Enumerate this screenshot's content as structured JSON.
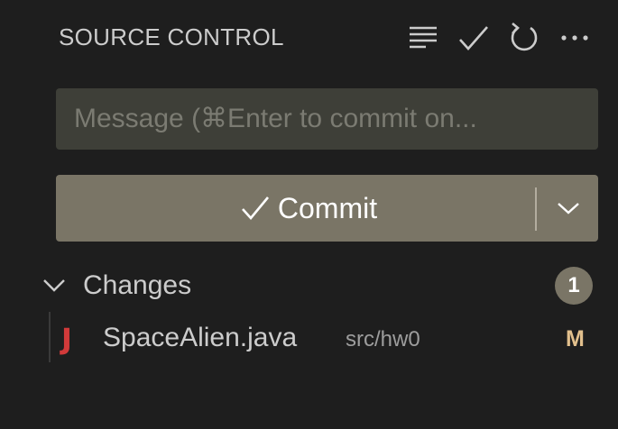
{
  "header": {
    "title": "SOURCE CONTROL",
    "actions": [
      {
        "name": "view-as-list-icon",
        "tooltip": ""
      },
      {
        "name": "commit-check-icon",
        "tooltip": ""
      },
      {
        "name": "refresh-icon",
        "tooltip": ""
      },
      {
        "name": "more-actions-icon",
        "tooltip": ""
      }
    ]
  },
  "message_input": {
    "value": "",
    "placeholder": "Message (⌘Enter to commit on..."
  },
  "commit_button": {
    "label": "Commit",
    "icon": "checkmark-icon",
    "dropdown_icon": "chevron-down-icon"
  },
  "changes": {
    "label": "Changes",
    "count": "1",
    "files": [
      {
        "icon_letter": "J",
        "name": "SpaceAlien.java",
        "path": "src/hw0",
        "status": "M"
      }
    ]
  },
  "colors": {
    "background": "#1e1e1e",
    "input_bg": "#3e3f38",
    "commit_bg": "#7a7566",
    "badge_bg": "#7a7566",
    "java_icon": "#d13a3a",
    "modified_status": "#e2c08d"
  }
}
